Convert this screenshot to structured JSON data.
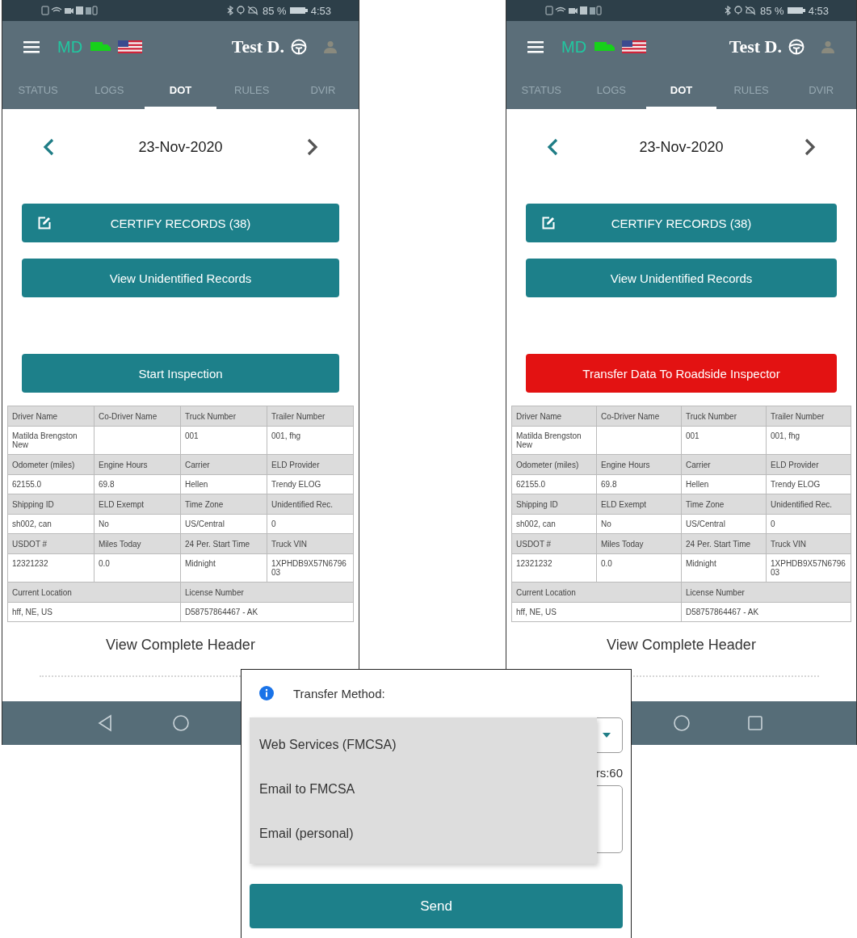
{
  "phones": [
    {
      "status_bar": {
        "battery": "85 %",
        "time": "4:53"
      },
      "app_bar": {
        "brand": "MD",
        "driver": "Test D."
      },
      "tabs": [
        {
          "label": "STATUS",
          "selected": false
        },
        {
          "label": "LOGS",
          "selected": false
        },
        {
          "label": "DOT",
          "selected": true
        },
        {
          "label": "RULES",
          "selected": false
        },
        {
          "label": "DVIR",
          "selected": false
        }
      ],
      "date": "23-Nov-2020",
      "buttons": [
        {
          "kind": "certify",
          "label": "CERTIFY RECORDS (38)"
        },
        {
          "kind": "primary",
          "label": "View Unidentified Records"
        },
        {
          "kind": "primary",
          "label": "Start Inspection"
        }
      ],
      "header_table": {
        "rows": [
          {
            "kind": "label",
            "cells": [
              "Driver Name",
              "Co-Driver Name",
              "Truck Number",
              "Trailer Number"
            ]
          },
          {
            "kind": "value",
            "cells": [
              "Matilda Brengston New",
              null,
              "001",
              "001, fhg"
            ]
          },
          {
            "kind": "label",
            "cells": [
              "Odometer (miles)",
              "Engine Hours",
              "Carrier",
              "ELD Provider"
            ]
          },
          {
            "kind": "value",
            "cells": [
              "62155.0",
              "69.8",
              "Hellen",
              "Trendy ELOG"
            ]
          },
          {
            "kind": "label",
            "cells": [
              "Shipping ID",
              "ELD Exempt",
              "Time Zone",
              "Unidentified Rec."
            ]
          },
          {
            "kind": "value",
            "cells": [
              "sh002, can",
              "No",
              "US/Central",
              "0"
            ]
          },
          {
            "kind": "label",
            "cells": [
              "USDOT #",
              "Miles Today",
              "24 Per. Start Time",
              "Truck VIN"
            ]
          },
          {
            "kind": "value",
            "cells": [
              "12321232",
              "0.0",
              "Midnight",
              "1XPHDB9X57N679603"
            ]
          },
          {
            "kind": "label",
            "cells": [
              "Current Location",
              "License Number"
            ]
          },
          {
            "kind": "value",
            "cells": [
              "hff, NE, US",
              "D58757864467 - AK"
            ]
          }
        ]
      },
      "link": "View Complete Header",
      "nav_buttons": [
        {
          "kind": "back"
        },
        {
          "kind": "home"
        }
      ]
    },
    {
      "status_bar": {
        "battery": "85 %",
        "time": "4:53"
      },
      "app_bar": {
        "brand": "MD",
        "driver": "Test D."
      },
      "tabs": [
        {
          "label": "STATUS",
          "selected": false
        },
        {
          "label": "LOGS",
          "selected": false
        },
        {
          "label": "DOT",
          "selected": true
        },
        {
          "label": "RULES",
          "selected": false
        },
        {
          "label": "DVIR",
          "selected": false
        }
      ],
      "date": "23-Nov-2020",
      "buttons": [
        {
          "kind": "certify",
          "label": "CERTIFY RECORDS (38)"
        },
        {
          "kind": "primary",
          "label": "View Unidentified Records"
        },
        {
          "kind": "danger",
          "label": "Transfer Data To Roadside Inspector"
        }
      ],
      "header_table": {
        "rows": [
          {
            "kind": "label",
            "cells": [
              "Driver Name",
              "Co-Driver Name",
              "Truck Number",
              "Trailer Number"
            ]
          },
          {
            "kind": "value",
            "cells": [
              "Matilda Brengston New",
              null,
              "001",
              "001, fhg"
            ]
          },
          {
            "kind": "label",
            "cells": [
              "Odometer (miles)",
              "Engine Hours",
              "Carrier",
              "ELD Provider"
            ]
          },
          {
            "kind": "value",
            "cells": [
              "62155.0",
              "69.8",
              "Hellen",
              "Trendy ELOG"
            ]
          },
          {
            "kind": "label",
            "cells": [
              "Shipping ID",
              "ELD Exempt",
              "Time Zone",
              "Unidentified Rec."
            ]
          },
          {
            "kind": "value",
            "cells": [
              "sh002, can",
              "No",
              "US/Central",
              "0"
            ]
          },
          {
            "kind": "label",
            "cells": [
              "USDOT #",
              "Miles Today",
              "24 Per. Start Time",
              "Truck VIN"
            ]
          },
          {
            "kind": "value",
            "cells": [
              "12321232",
              "0.0",
              "Midnight",
              "1XPHDB9X57N679603"
            ]
          },
          {
            "kind": "label",
            "cells": [
              "Current Location",
              "License Number"
            ]
          },
          {
            "kind": "value",
            "cells": [
              "hff, NE, US",
              "D58757864467 - AK"
            ]
          }
        ]
      },
      "link": "View Complete Header",
      "nav_buttons": [
        {
          "kind": "home"
        },
        {
          "kind": "recents"
        }
      ]
    }
  ],
  "dialog": {
    "title": "Transfer Method:",
    "hidden_label": "rs:60",
    "options": [
      "Web Services (FMCSA)",
      "Email to FMCSA",
      "Email (personal)"
    ],
    "send": "Send"
  }
}
